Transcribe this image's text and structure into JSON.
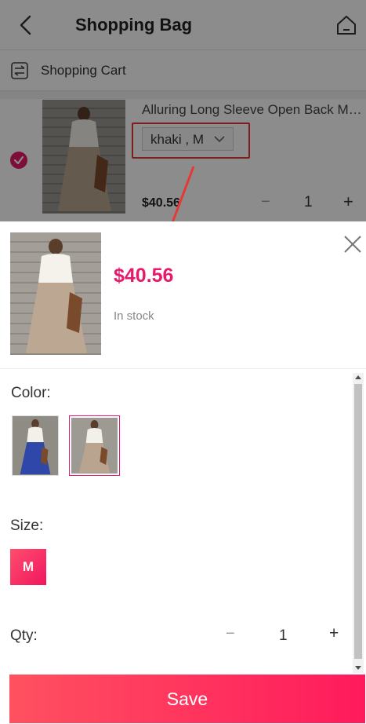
{
  "header": {
    "title": "Shopping Bag",
    "back_icon": "chevron-left-icon",
    "home_icon": "home-icon"
  },
  "cart_row": {
    "label": "Shopping Cart",
    "icon": "swap-arrows-icon"
  },
  "cart_item": {
    "name": "Alluring Long Sleeve Open Back Maxi Dress",
    "variant": "khaki , M",
    "price": "$40.56",
    "quantity": "1",
    "minus": "−",
    "plus": "+",
    "checked": true
  },
  "sheet": {
    "price": "$40.56",
    "stock": "In stock",
    "color_label": "Color:",
    "colors": [
      {
        "name": "blue",
        "selected": false
      },
      {
        "name": "khaki",
        "selected": true
      }
    ],
    "size_label": "Size:",
    "sizes": [
      "M"
    ],
    "selected_size": "M",
    "qty_label": "Qty:",
    "quantity": "1",
    "minus": "−",
    "plus": "+",
    "save_label": "Save"
  },
  "colors": {
    "accent": "#e8196b",
    "annotation": "#e53935",
    "save_gradient_start": "#ff5160",
    "save_gradient_end": "#ff1a5c"
  }
}
